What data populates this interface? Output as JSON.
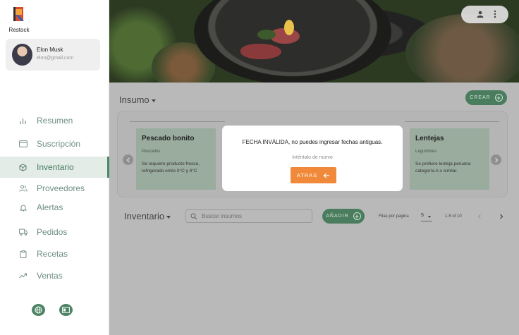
{
  "app": {
    "name": "Restock",
    "brand_color": "#4a7d5d",
    "accent_color": "#f08a3a"
  },
  "user": {
    "name": "Elon Musk",
    "email": "elon@gmail.com"
  },
  "nav": {
    "items": [
      {
        "label": "Resumen",
        "icon": "bar-chart-icon",
        "active": false
      },
      {
        "label": "Suscripción",
        "icon": "credit-card-icon",
        "active": false
      },
      {
        "label": "Inventario",
        "icon": "cube-icon",
        "active": true
      },
      {
        "label": "Proveedores",
        "icon": "users-icon",
        "active": false
      },
      {
        "label": "Alertas",
        "icon": "bell-icon",
        "active": false
      },
      {
        "label": "Pedidos",
        "icon": "truck-icon",
        "active": false
      },
      {
        "label": "Recetas",
        "icon": "clipboard-icon",
        "active": false
      },
      {
        "label": "Ventas",
        "icon": "trending-up-icon",
        "active": false
      }
    ],
    "bottom_buttons": [
      "globe-icon",
      "layout-icon"
    ]
  },
  "insumo": {
    "title": "Insumo",
    "create_label": "CREAR",
    "cards": [
      {
        "title": "Pescado bonito",
        "category": "Pescados",
        "description": "Se requiere producto fresco, refrigerado entre 0°C y 4°C"
      },
      {
        "title": "Lentejas",
        "category": "Legumbres",
        "description": "Se prefiere lenteja peruana categoría A o similar."
      }
    ]
  },
  "inventario": {
    "title": "Inventario",
    "search_placeholder": "Buscar insumos",
    "add_label": "AÑADIR",
    "rows_per_page_label": "Filas por pagina",
    "rows_per_page_value": "5",
    "range_label": "1-5 of 10"
  },
  "modal": {
    "message": "FECHA INVÁLIDA, no puedes ingresar fechas antiguas.",
    "sub_message": "Inténtalo de nuevo",
    "button_label": "ATRAS"
  }
}
